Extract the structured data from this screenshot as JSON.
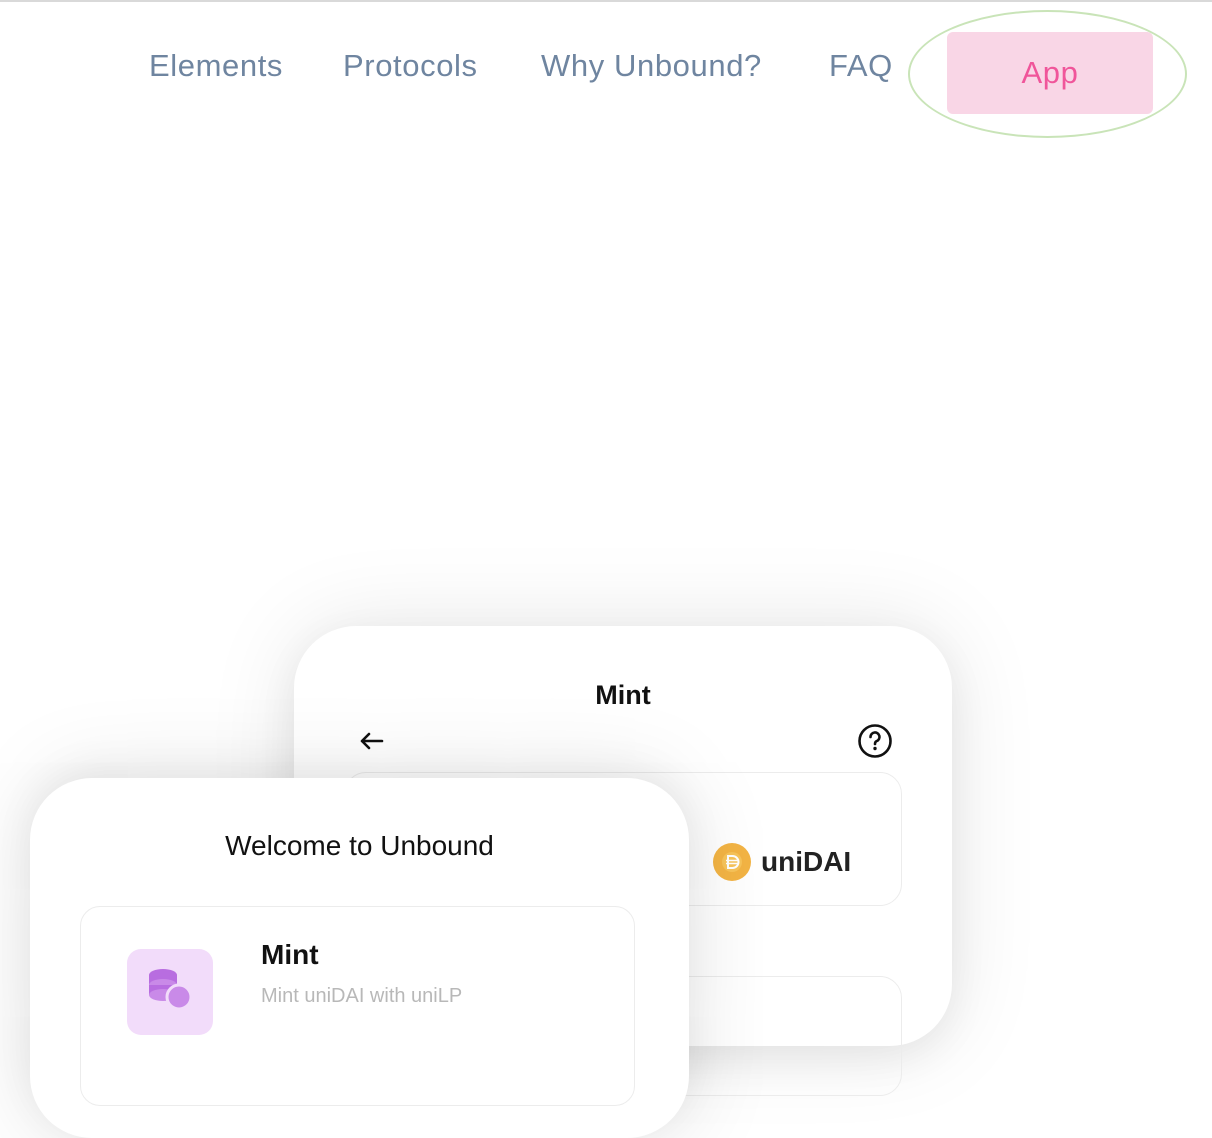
{
  "nav": {
    "items": [
      "Elements",
      "Protocols",
      "Why Unbound?",
      "FAQ"
    ],
    "app_button": "App"
  },
  "mint_card": {
    "title": "Mint",
    "token": {
      "label": "uniDAI",
      "icon": "dai-coin-icon",
      "color": "#f3b444"
    }
  },
  "welcome_card": {
    "title": "Welcome to Unbound",
    "option": {
      "title": "Mint",
      "subtitle": "Mint uniDAI with uniLP",
      "icon": "coins-stack-icon"
    }
  },
  "colors": {
    "nav_text": "#6f85a0",
    "app_bg": "#f9d6e6",
    "app_text": "#f0559a",
    "highlight": "#c9e4b8"
  }
}
